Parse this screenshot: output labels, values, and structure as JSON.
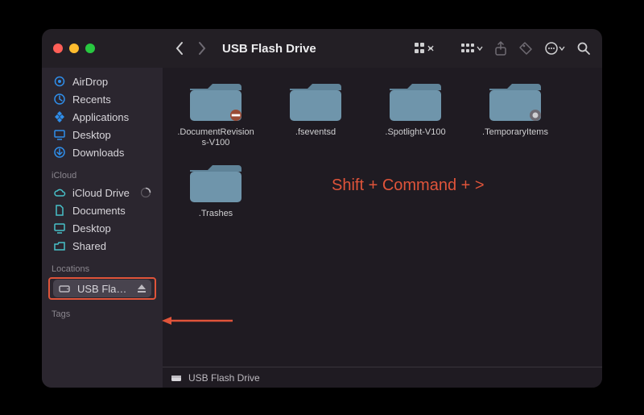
{
  "colors": {
    "accent": "#e0543a",
    "folder": "#6f95ab",
    "folder_tab": "#5f8398"
  },
  "window": {
    "title": "USB Flash Drive"
  },
  "toolbar": {
    "back_icon": "chevron-left",
    "forward_icon": "chevron-right",
    "view_icon": "grid-icon",
    "group_icon": "group-icon",
    "share_icon": "share-icon",
    "tag_icon": "tag-icon",
    "actions_icon": "more-icon",
    "search_icon": "search-icon"
  },
  "sidebar": {
    "favorites": [
      {
        "icon": "airdrop-icon",
        "color": "#2f8eea",
        "label": "AirDrop"
      },
      {
        "icon": "clock-icon",
        "color": "#2f8eea",
        "label": "Recents"
      },
      {
        "icon": "app-icon",
        "color": "#2f8eea",
        "label": "Applications"
      },
      {
        "icon": "desktop-icon",
        "color": "#2f8eea",
        "label": "Desktop"
      },
      {
        "icon": "downloads-icon",
        "color": "#2f8eea",
        "label": "Downloads"
      }
    ],
    "icloud_label": "iCloud",
    "icloud": [
      {
        "icon": "cloud-icon",
        "color": "#48c0c9",
        "label": "iCloud Drive",
        "trail": "progress-icon"
      },
      {
        "icon": "doc-icon",
        "color": "#48c0c9",
        "label": "Documents"
      },
      {
        "icon": "desktop-icon",
        "color": "#48c0c9",
        "label": "Desktop"
      },
      {
        "icon": "shared-icon",
        "color": "#48c0c9",
        "label": "Shared"
      }
    ],
    "locations_label": "Locations",
    "locations": [
      {
        "icon": "drive-icon",
        "color": "#bdbac0",
        "label": "USB Flash…",
        "trail": "eject-icon",
        "selected": true
      }
    ],
    "tags_label": "Tags"
  },
  "files": [
    {
      "name": ".DocumentRevisions-V100",
      "badge": "deny"
    },
    {
      "name": ".fseventsd"
    },
    {
      "name": ".Spotlight-V100"
    },
    {
      "name": ".TemporaryItems",
      "badge": "gray"
    },
    {
      "name": ".Trashes"
    }
  ],
  "overlay_hint": "Shift + Command + >",
  "pathbar": {
    "icon": "drive-small-icon",
    "label": "USB Flash Drive"
  }
}
